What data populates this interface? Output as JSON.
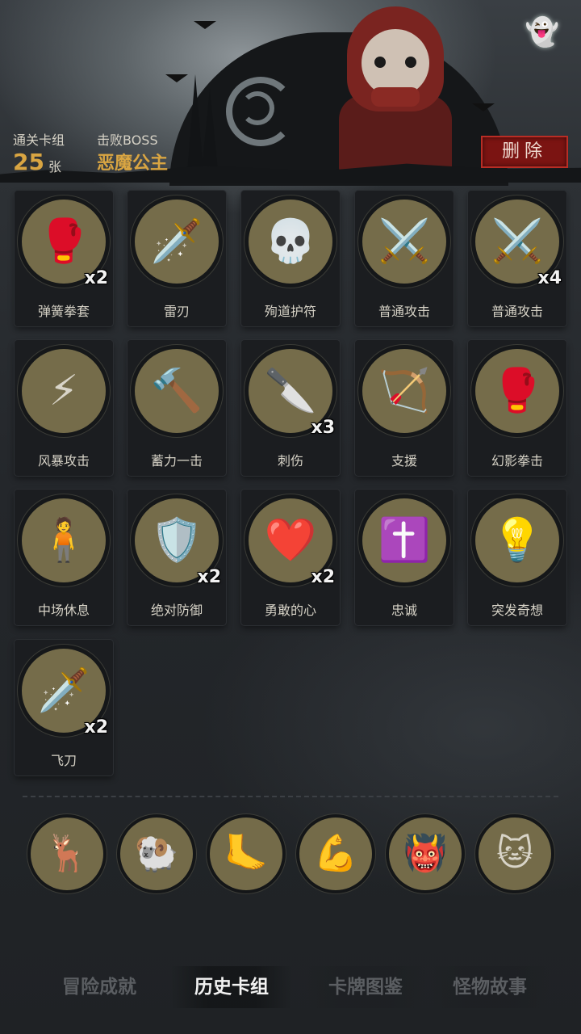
{
  "header": {
    "cleared_decks_label": "通关卡组",
    "cleared_decks_value": "25",
    "cleared_decks_unit": "张",
    "defeated_boss_label": "击败BOSS",
    "defeated_boss_value": "恶魔公主",
    "delete_label": "删除",
    "ghost_icon": "👻"
  },
  "cards": [
    {
      "name": "弹簧拳套",
      "count": "x2",
      "icon": "🥊"
    },
    {
      "name": "雷刃",
      "count": "",
      "icon": "🗡️"
    },
    {
      "name": "殉道护符",
      "count": "",
      "icon": "💀"
    },
    {
      "name": "普通攻击",
      "count": "",
      "icon": "⚔️"
    },
    {
      "name": "普通攻击",
      "count": "x4",
      "icon": "⚔️"
    },
    {
      "name": "风暴攻击",
      "count": "",
      "icon": "⚡"
    },
    {
      "name": "蓄力一击",
      "count": "",
      "icon": "🔨"
    },
    {
      "name": "刺伤",
      "count": "x3",
      "icon": "🔪"
    },
    {
      "name": "支援",
      "count": "",
      "icon": "🏹"
    },
    {
      "name": "幻影拳击",
      "count": "",
      "icon": "🥊"
    },
    {
      "name": "中场休息",
      "count": "",
      "icon": "🧍"
    },
    {
      "name": "绝对防御",
      "count": "x2",
      "icon": "🛡️"
    },
    {
      "name": "勇敢的心",
      "count": "x2",
      "icon": "❤️"
    },
    {
      "name": "忠诚",
      "count": "",
      "icon": "✝️"
    },
    {
      "name": "突发奇想",
      "count": "",
      "icon": "💡"
    },
    {
      "name": "飞刀",
      "count": "x2",
      "icon": "🗡️"
    }
  ],
  "bosses": [
    {
      "name": "deer-boss",
      "icon": "🦌"
    },
    {
      "name": "skull-boss",
      "icon": "🐏"
    },
    {
      "name": "giant-boss",
      "icon": "🦶"
    },
    {
      "name": "arm-boss",
      "icon": "💪"
    },
    {
      "name": "demon-boss",
      "icon": "👹"
    },
    {
      "name": "cat-boss",
      "icon": "🐱"
    }
  ],
  "tabs": [
    {
      "label": "冒险成就",
      "active": false
    },
    {
      "label": "历史卡组",
      "active": true
    },
    {
      "label": "卡牌图鉴",
      "active": false
    },
    {
      "label": "怪物故事",
      "active": false
    }
  ]
}
